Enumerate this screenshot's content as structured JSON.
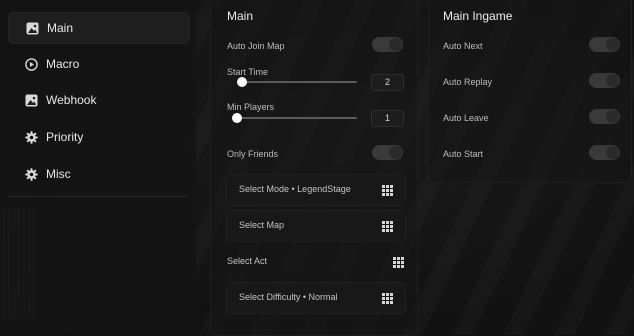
{
  "sidebar": {
    "items": [
      {
        "label": "Main",
        "icon": "image-icon",
        "active": true
      },
      {
        "label": "Macro",
        "icon": "play-circle-icon",
        "active": false
      },
      {
        "label": "Webhook",
        "icon": "image-icon",
        "active": false
      },
      {
        "label": "Priority",
        "icon": "gear-icon",
        "active": false
      },
      {
        "label": "Misc",
        "icon": "gear-icon",
        "active": false
      }
    ]
  },
  "main": {
    "title": "Main",
    "auto_join_map": {
      "label": "Auto Join Map",
      "on": false
    },
    "start_time": {
      "label": "Start Time",
      "value": "2",
      "fraction": 0.0
    },
    "min_players": {
      "label": "Min Players",
      "value": "1",
      "fraction": 0.0
    },
    "only_friends": {
      "label": "Only Friends",
      "on": false
    },
    "select_mode": {
      "label": "Select Mode • LegendStage"
    },
    "select_map": {
      "label": "Select Map"
    },
    "select_act": {
      "label": "Select Act"
    },
    "select_difficulty": {
      "label": "Select Difficulty • Normal"
    }
  },
  "ingame": {
    "title": "Main Ingame",
    "toggles": [
      {
        "label": "Auto Next",
        "on": false
      },
      {
        "label": "Auto Replay",
        "on": false
      },
      {
        "label": "Auto Leave",
        "on": false
      },
      {
        "label": "Auto Start",
        "on": false
      }
    ]
  },
  "colors": {
    "background": "#121212",
    "panel": "#161616",
    "toggle_off": "#3a3a3a",
    "text": "#e6e6e6"
  }
}
